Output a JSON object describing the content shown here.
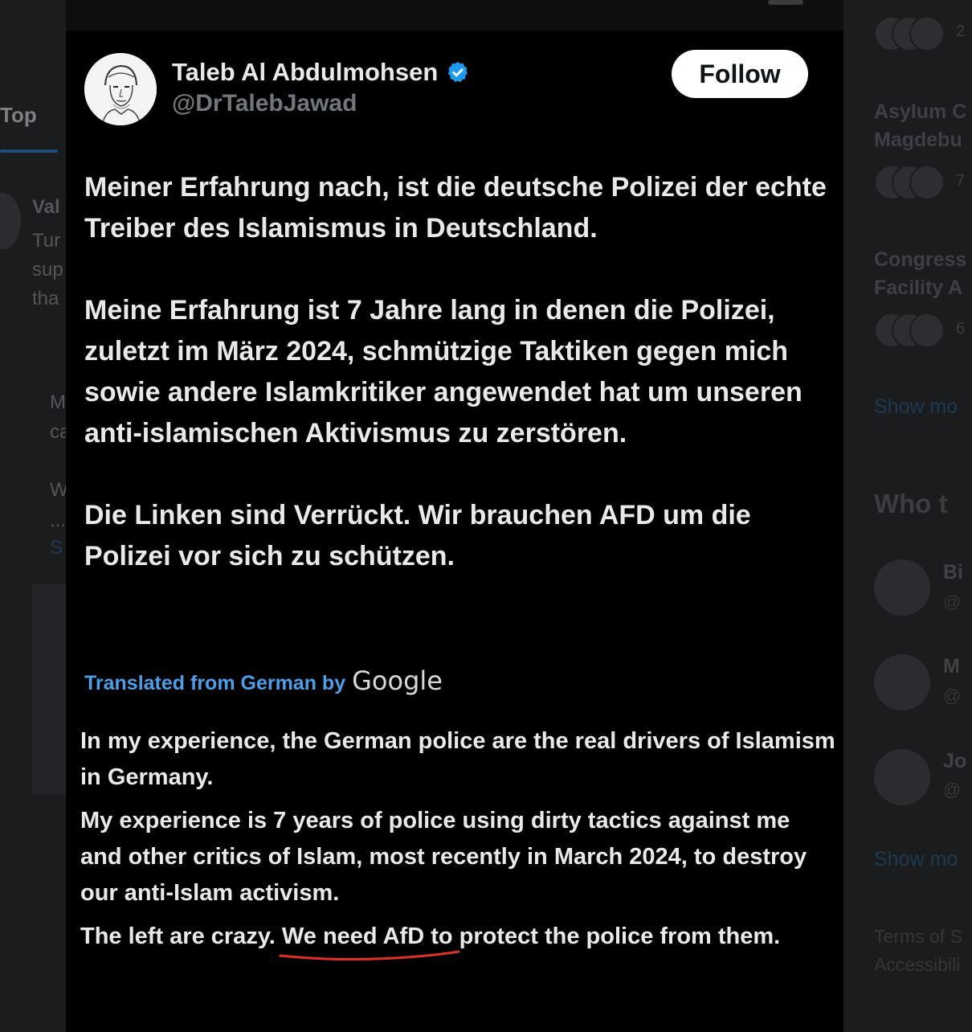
{
  "background": {
    "left_tab": "Top",
    "left_snippets": [
      "Val",
      "Tur",
      "sup",
      "tha",
      "M",
      "ca",
      "W",
      "...",
      "S"
    ],
    "right_trends": [
      {
        "title_lines": [
          "Asylum C",
          "Magdebu"
        ],
        "count": "7"
      },
      {
        "title_lines": [
          "Congress",
          "Facility A"
        ],
        "count": "6"
      }
    ],
    "top_count": "2",
    "show_more_1": "Show mo",
    "who_to_follow_title": "Who t",
    "who_to_follow": [
      {
        "name": "Bi",
        "handle": "@"
      },
      {
        "name": "M",
        "handle": "@"
      },
      {
        "name": "Jo",
        "handle": "@"
      }
    ],
    "show_more_2": "Show mo",
    "footer_links": [
      "Terms of S",
      "Accessibili"
    ]
  },
  "tweet": {
    "display_name": "Taleb Al Abdulmohsen",
    "handle": "@DrTalebJawad",
    "follow_label": "Follow",
    "paragraphs": [
      "Meiner Erfahrung nach, ist die deutsche Polizei der echte Treiber des Islamismus in Deutschland.",
      "Meine Erfahrung ist 7 Jahre lang in denen die Polizei, zuletzt im März 2024, schmützige Taktiken gegen mich sowie andere Islamkritiker angewendet hat um unseren anti-islamischen Aktivismus zu zerstören.",
      "Die Linken sind Verrückt. Wir brauchen AFD um die Polizei vor sich zu schützen."
    ],
    "translated_label": "Translated from German by",
    "translated_brand": "Google",
    "translation": {
      "p1": "In my experience, the German police are the real drivers of Islamism in Germany.",
      "p2": "My experience is 7 years of police using dirty tactics against me and other critics of Islam, most recently in March 2024, to destroy our anti-Islam activism.",
      "p3_before": "The left are crazy. ",
      "p3_underlined": "We need AfD to",
      "p3_after": " protect the police from them."
    }
  },
  "colors": {
    "card_bg": "#000000",
    "verified_blue": "#1d9bf0",
    "translate_link": "#4a9fe8",
    "annotation_red": "#e0302a"
  }
}
